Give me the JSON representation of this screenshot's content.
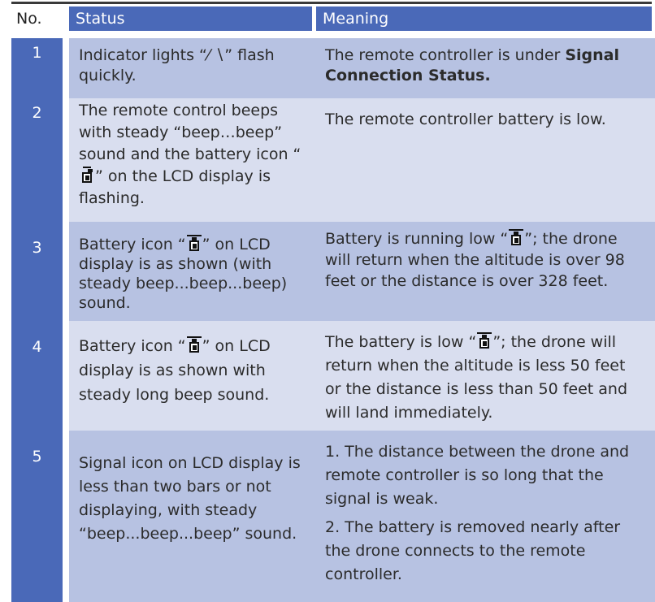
{
  "header": {
    "no": "No.",
    "status": "Status",
    "meaning": "Meaning"
  },
  "rows": [
    {
      "no": "1",
      "status_before": "Indicator lights “",
      "status_glyph": "⁄ ∖",
      "status_after": "” flash quickly.",
      "meaning_before": "The remote controller is under ",
      "meaning_bold": "Signal Connection Status."
    },
    {
      "no": "2",
      "status_before": "The remote control beeps with steady “beep…beep” sound and the battery icon “",
      "status_after": "” on the LCD display is flashing.",
      "meaning": "The remote controller battery is low."
    },
    {
      "no": "3",
      "status_before": "Battery icon “",
      "status_after": "” on LCD display is as shown (with steady beep...beep...beep) sound.",
      "meaning_before": "Battery is running low “",
      "meaning_after": "”; the drone will return when the altitude is over 98 feet or the distance is over 328 feet."
    },
    {
      "no": "4",
      "status_before": "Battery icon “",
      "status_after": "” on LCD display is as shown with steady long beep sound.",
      "meaning_before": "The battery is low “",
      "meaning_after": "”; the drone will return when the altitude is less 50 feet or the distance is less than 50 feet and will land immediately."
    },
    {
      "no": "5",
      "status": "Signal icon on LCD display is less than two bars or not displaying, with steady “beep...beep...beep” sound.",
      "meaning_1": "1. The distance between the drone and remote controller is so long that the signal is weak.",
      "meaning_2": "2. The battery is removed nearly after the drone connects to the remote controller."
    }
  ],
  "icons": [
    "drone-battery-icon",
    "battery-icon"
  ]
}
